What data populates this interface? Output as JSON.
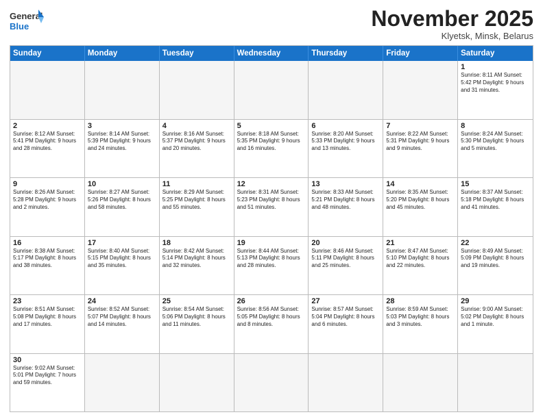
{
  "header": {
    "logo_general": "General",
    "logo_blue": "Blue",
    "month_title": "November 2025",
    "location": "Klyetsk, Minsk, Belarus"
  },
  "weekdays": [
    "Sunday",
    "Monday",
    "Tuesday",
    "Wednesday",
    "Thursday",
    "Friday",
    "Saturday"
  ],
  "rows": [
    [
      {
        "day": "",
        "info": "",
        "empty": true
      },
      {
        "day": "",
        "info": "",
        "empty": true
      },
      {
        "day": "",
        "info": "",
        "empty": true
      },
      {
        "day": "",
        "info": "",
        "empty": true
      },
      {
        "day": "",
        "info": "",
        "empty": true
      },
      {
        "day": "",
        "info": "",
        "empty": true
      },
      {
        "day": "1",
        "info": "Sunrise: 8:11 AM\nSunset: 5:42 PM\nDaylight: 9 hours\nand 31 minutes."
      }
    ],
    [
      {
        "day": "2",
        "info": "Sunrise: 8:12 AM\nSunset: 5:41 PM\nDaylight: 9 hours\nand 28 minutes."
      },
      {
        "day": "3",
        "info": "Sunrise: 8:14 AM\nSunset: 5:39 PM\nDaylight: 9 hours\nand 24 minutes."
      },
      {
        "day": "4",
        "info": "Sunrise: 8:16 AM\nSunset: 5:37 PM\nDaylight: 9 hours\nand 20 minutes."
      },
      {
        "day": "5",
        "info": "Sunrise: 8:18 AM\nSunset: 5:35 PM\nDaylight: 9 hours\nand 16 minutes."
      },
      {
        "day": "6",
        "info": "Sunrise: 8:20 AM\nSunset: 5:33 PM\nDaylight: 9 hours\nand 13 minutes."
      },
      {
        "day": "7",
        "info": "Sunrise: 8:22 AM\nSunset: 5:31 PM\nDaylight: 9 hours\nand 9 minutes."
      },
      {
        "day": "8",
        "info": "Sunrise: 8:24 AM\nSunset: 5:30 PM\nDaylight: 9 hours\nand 5 minutes."
      }
    ],
    [
      {
        "day": "9",
        "info": "Sunrise: 8:26 AM\nSunset: 5:28 PM\nDaylight: 9 hours\nand 2 minutes."
      },
      {
        "day": "10",
        "info": "Sunrise: 8:27 AM\nSunset: 5:26 PM\nDaylight: 8 hours\nand 58 minutes."
      },
      {
        "day": "11",
        "info": "Sunrise: 8:29 AM\nSunset: 5:25 PM\nDaylight: 8 hours\nand 55 minutes."
      },
      {
        "day": "12",
        "info": "Sunrise: 8:31 AM\nSunset: 5:23 PM\nDaylight: 8 hours\nand 51 minutes."
      },
      {
        "day": "13",
        "info": "Sunrise: 8:33 AM\nSunset: 5:21 PM\nDaylight: 8 hours\nand 48 minutes."
      },
      {
        "day": "14",
        "info": "Sunrise: 8:35 AM\nSunset: 5:20 PM\nDaylight: 8 hours\nand 45 minutes."
      },
      {
        "day": "15",
        "info": "Sunrise: 8:37 AM\nSunset: 5:18 PM\nDaylight: 8 hours\nand 41 minutes."
      }
    ],
    [
      {
        "day": "16",
        "info": "Sunrise: 8:38 AM\nSunset: 5:17 PM\nDaylight: 8 hours\nand 38 minutes."
      },
      {
        "day": "17",
        "info": "Sunrise: 8:40 AM\nSunset: 5:15 PM\nDaylight: 8 hours\nand 35 minutes."
      },
      {
        "day": "18",
        "info": "Sunrise: 8:42 AM\nSunset: 5:14 PM\nDaylight: 8 hours\nand 32 minutes."
      },
      {
        "day": "19",
        "info": "Sunrise: 8:44 AM\nSunset: 5:13 PM\nDaylight: 8 hours\nand 28 minutes."
      },
      {
        "day": "20",
        "info": "Sunrise: 8:46 AM\nSunset: 5:11 PM\nDaylight: 8 hours\nand 25 minutes."
      },
      {
        "day": "21",
        "info": "Sunrise: 8:47 AM\nSunset: 5:10 PM\nDaylight: 8 hours\nand 22 minutes."
      },
      {
        "day": "22",
        "info": "Sunrise: 8:49 AM\nSunset: 5:09 PM\nDaylight: 8 hours\nand 19 minutes."
      }
    ],
    [
      {
        "day": "23",
        "info": "Sunrise: 8:51 AM\nSunset: 5:08 PM\nDaylight: 8 hours\nand 17 minutes."
      },
      {
        "day": "24",
        "info": "Sunrise: 8:52 AM\nSunset: 5:07 PM\nDaylight: 8 hours\nand 14 minutes."
      },
      {
        "day": "25",
        "info": "Sunrise: 8:54 AM\nSunset: 5:06 PM\nDaylight: 8 hours\nand 11 minutes."
      },
      {
        "day": "26",
        "info": "Sunrise: 8:56 AM\nSunset: 5:05 PM\nDaylight: 8 hours\nand 8 minutes."
      },
      {
        "day": "27",
        "info": "Sunrise: 8:57 AM\nSunset: 5:04 PM\nDaylight: 8 hours\nand 6 minutes."
      },
      {
        "day": "28",
        "info": "Sunrise: 8:59 AM\nSunset: 5:03 PM\nDaylight: 8 hours\nand 3 minutes."
      },
      {
        "day": "29",
        "info": "Sunrise: 9:00 AM\nSunset: 5:02 PM\nDaylight: 8 hours\nand 1 minute."
      }
    ],
    [
      {
        "day": "30",
        "info": "Sunrise: 9:02 AM\nSunset: 5:01 PM\nDaylight: 7 hours\nand 59 minutes."
      },
      {
        "day": "",
        "info": "",
        "empty": true
      },
      {
        "day": "",
        "info": "",
        "empty": true
      },
      {
        "day": "",
        "info": "",
        "empty": true
      },
      {
        "day": "",
        "info": "",
        "empty": true
      },
      {
        "day": "",
        "info": "",
        "empty": true
      },
      {
        "day": "",
        "info": "",
        "empty": true
      }
    ]
  ]
}
